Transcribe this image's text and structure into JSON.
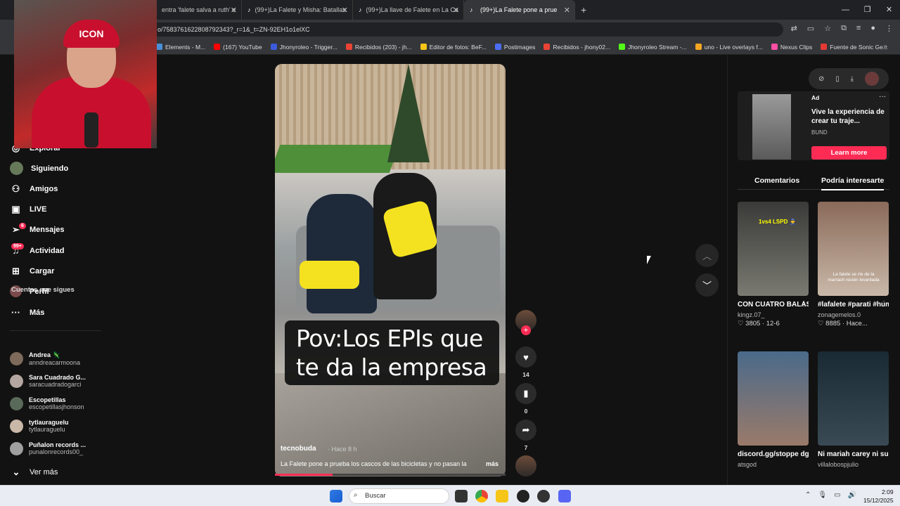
{
  "tabs": [
    {
      "label": "entra 'falete salva a ruth' e",
      "active": false
    },
    {
      "label": "(99+)La Falete y Misha: Batallas",
      "active": false
    },
    {
      "label": "(99+)La llave de Falete en La Ca",
      "active": false
    },
    {
      "label": "(99+)La Falete pone a prue",
      "active": true
    }
  ],
  "address": {
    "url": "o/7583761622808792343?_r=1&_t=ZN-92EH1o1elXC"
  },
  "bookmarks": [
    {
      "label": "Elements - M...",
      "color": "#4a90d9"
    },
    {
      "label": "(167) YouTube",
      "color": "#ff0000"
    },
    {
      "label": "Jhonyroleo - Trigger...",
      "color": "#3b5bdb"
    },
    {
      "label": "Recibidos (203) - jh...",
      "color": "#ea4335"
    },
    {
      "label": "Editor de fotos: BeF...",
      "color": "#f5c518"
    },
    {
      "label": "Postimages",
      "color": "#4b6ef5"
    },
    {
      "label": "Recibidos - jhony02...",
      "color": "#ea4335"
    },
    {
      "label": "Jhonyroleo Stream -...",
      "color": "#53fc18"
    },
    {
      "label": "uno - Live overlays f...",
      "color": "#f5a623"
    },
    {
      "label": "Nexus Clips",
      "color": "#ff4ea3"
    },
    {
      "label": "Fuente de Sonic Ge...",
      "color": "#e53935"
    }
  ],
  "webcam": {
    "cap_text": "ICON"
  },
  "sidebar": {
    "items": [
      {
        "label": "Explorar",
        "icon": "compass-icon"
      },
      {
        "label": "Siguiendo",
        "icon": "avatar-icon"
      },
      {
        "label": "Amigos",
        "icon": "people-icon"
      },
      {
        "label": "LIVE",
        "icon": "live-icon"
      },
      {
        "label": "Mensajes",
        "icon": "paper-plane-icon",
        "badge": "6"
      },
      {
        "label": "Actividad",
        "icon": "bell-icon",
        "badge": "99+"
      },
      {
        "label": "Cargar",
        "icon": "plus-square-icon"
      },
      {
        "label": "Perfil",
        "icon": "profile-icon"
      },
      {
        "label": "Más",
        "icon": "more-icon"
      }
    ],
    "following_title": "Cuentas que sigues",
    "following": [
      {
        "name": "Andrea 🦎",
        "user": "anndreacarmoona"
      },
      {
        "name": "Sara Cuadrado G...",
        "user": "saracuadradogarci"
      },
      {
        "name": "Escopetillas",
        "user": "escopetillasjhonson"
      },
      {
        "name": "tytlauraguelu",
        "user": "tytlauraguelu"
      },
      {
        "name": "Puñalon records ...",
        "user": "punalonrecords00_"
      }
    ],
    "see_more": "Ver más"
  },
  "video": {
    "caption_line1": "Pov:Los EPIs que",
    "caption_line2": "te da la empresa",
    "author": "tecnobuda",
    "time": "· Hace 8 h",
    "description": "La Falete pone a prueba los cascos de las bicicletas y no pasan la",
    "more": "más",
    "progress": 0.25
  },
  "actions": {
    "likes": "14",
    "saves": "0",
    "shares": "7"
  },
  "right": {
    "ad": {
      "label": "Ad",
      "title": "Vive la experiencia de crear tu traje...",
      "brand": "BUND",
      "button": "Learn more"
    },
    "tabs": [
      "Comentarios",
      "Podría interesarte"
    ],
    "cards": [
      {
        "title": "CON CUATRO BALAS BASTA 😂...",
        "author": "kingz.07_",
        "stats": "♡ 3805 · 12-6",
        "overlay": "1vs4 LSPD 👮",
        "bg": "#4a4a48"
      },
      {
        "title": "#lafalete #parati #humor...",
        "author": "zonagemelos.0",
        "stats": "♡ 8885 · Hace...",
        "overlay": "La falete se ríe de la marrash recién levantada",
        "bg": "#7a5a4a"
      },
      {
        "title": "discord.gg/stoppe dgg #atsgod...",
        "author": "atsgod",
        "stats": "",
        "overlay": "",
        "bg": "#5a6a7a"
      },
      {
        "title": "Ni mariah carey ni su prima 🎤...",
        "author": "villalobospjulio",
        "stats": "",
        "overlay": "",
        "bg": "#2a3a44"
      }
    ]
  },
  "taskbar": {
    "search": "Buscar",
    "time": "2:09",
    "date": "15/12/2025"
  }
}
